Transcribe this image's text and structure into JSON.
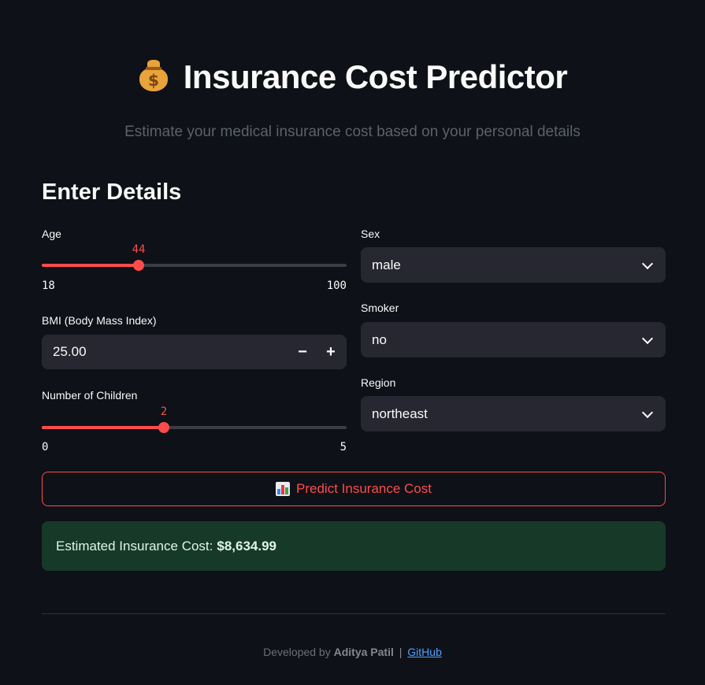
{
  "header": {
    "title": "Insurance Cost Predictor",
    "subtitle": "Estimate your medical insurance cost based on your personal details",
    "icon": "money-bag-icon"
  },
  "form": {
    "heading": "Enter Details",
    "age": {
      "label": "Age",
      "value": 44,
      "min": 18,
      "max": 100
    },
    "bmi": {
      "label": "BMI (Body Mass Index)",
      "value": "25.00",
      "decrement": "−",
      "increment": "+"
    },
    "children": {
      "label": "Number of Children",
      "value": 2,
      "min": 0,
      "max": 5
    },
    "sex": {
      "label": "Sex",
      "value": "male"
    },
    "smoker": {
      "label": "Smoker",
      "value": "no"
    },
    "region": {
      "label": "Region",
      "value": "northeast"
    }
  },
  "predict_button": {
    "label": "Predict Insurance Cost",
    "icon": "bar-chart-icon"
  },
  "result": {
    "prefix": "Estimated Insurance Cost:",
    "value": "$8,634.99"
  },
  "footer": {
    "prefix": "Developed by",
    "author": "Aditya Patil",
    "separator": "|",
    "link": "GitHub"
  },
  "colors": {
    "background": "#0e1117",
    "accent": "#ff4b4b",
    "input_bg": "#262730",
    "success_bg": "#173928",
    "link": "#4ea1ff"
  }
}
